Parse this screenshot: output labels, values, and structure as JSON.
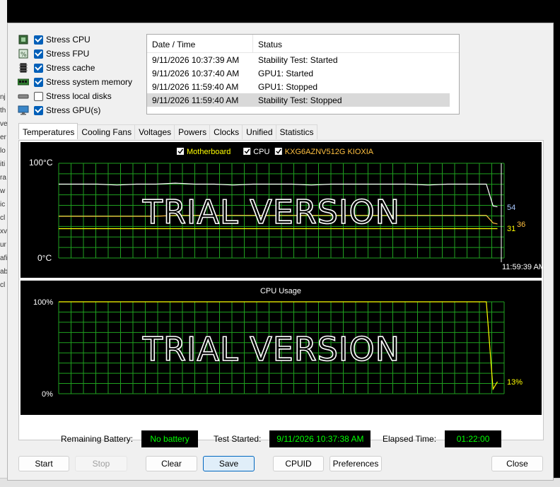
{
  "background_fragments": [
    "nj",
    "th",
    "ve",
    "er",
    "lo",
    "iti",
    "ra",
    "w",
    "ic",
    "cl",
    "xv",
    "ur",
    "afi",
    "ab",
    "cl"
  ],
  "options": [
    {
      "label": "Stress CPU",
      "checked": true,
      "icon": "cpu-chip-icon"
    },
    {
      "label": "Stress FPU",
      "checked": true,
      "icon": "fpu-chip-icon"
    },
    {
      "label": "Stress cache",
      "checked": true,
      "icon": "cache-chip-icon"
    },
    {
      "label": "Stress system memory",
      "checked": true,
      "icon": "memory-module-icon"
    },
    {
      "label": "Stress local disks",
      "checked": false,
      "icon": "disk-drive-icon"
    },
    {
      "label": "Stress GPU(s)",
      "checked": true,
      "icon": "monitor-icon"
    }
  ],
  "log": {
    "headers": [
      "Date / Time",
      "Status"
    ],
    "rows": [
      {
        "time": "9/11/2026 10:37:39 AM",
        "status": "Stability Test: Started"
      },
      {
        "time": "9/11/2026 10:37:40 AM",
        "status": "GPU1: Started"
      },
      {
        "time": "9/11/2026 11:59:40 AM",
        "status": "GPU1: Stopped"
      },
      {
        "time": "9/11/2026 11:59:40 AM",
        "status": "Stability Test: Stopped"
      }
    ]
  },
  "tabs": [
    "Temperatures",
    "Cooling Fans",
    "Voltages",
    "Powers",
    "Clocks",
    "Unified",
    "Statistics"
  ],
  "temp_graph": {
    "legend": [
      {
        "label": "Motherboard",
        "color": "#ffff00",
        "checked": true
      },
      {
        "label": "CPU",
        "color": "#ffffff",
        "checked": true
      },
      {
        "label": "KXG6AZNV512G KIOXIA",
        "color": "#ffc040",
        "checked": true
      }
    ],
    "y_top": "100°C",
    "y_bottom": "0°C",
    "watermark": "TRIAL VERSION",
    "time_label": "11:59:39 AM",
    "value_labels": [
      {
        "text": "54",
        "color": "#a8c8ff"
      },
      {
        "text": "31",
        "color": "#ffff00"
      },
      {
        "text": "36",
        "color": "#ffc040"
      }
    ]
  },
  "cpu_graph": {
    "title": "CPU Usage",
    "y_top": "100%",
    "y_bottom": "0%",
    "watermark": "TRIAL VERSION",
    "value_label": "13%",
    "color": "#ffff00"
  },
  "chart_data": [
    {
      "type": "line",
      "title": "",
      "ylim": [
        0,
        100
      ],
      "ylabel": "°C",
      "grid": true,
      "series": [
        {
          "name": "Motherboard",
          "values": [
            31,
            31,
            31,
            31,
            31,
            31,
            31,
            31,
            31,
            31,
            31,
            31,
            31,
            31,
            31,
            31,
            31,
            31,
            31,
            31,
            31,
            31,
            31,
            31,
            31
          ]
        },
        {
          "name": "CPU",
          "values": [
            78,
            78,
            78,
            77,
            78,
            78,
            79,
            78,
            78,
            77,
            78,
            78,
            78,
            77,
            78,
            78,
            78,
            78,
            78,
            77,
            78,
            78,
            78,
            55,
            54
          ]
        },
        {
          "name": "KXG6AZNV512G KIOXIA",
          "values": [
            44,
            44,
            44,
            44,
            44,
            44,
            45,
            45,
            45,
            45,
            45,
            45,
            45,
            45,
            45,
            45,
            45,
            45,
            45,
            45,
            45,
            45,
            45,
            37,
            36
          ]
        }
      ]
    },
    {
      "type": "line",
      "title": "CPU Usage",
      "ylim": [
        0,
        100
      ],
      "grid": true,
      "series": [
        {
          "name": "CPU Usage",
          "values": [
            100,
            100,
            100,
            100,
            100,
            100,
            100,
            100,
            100,
            100,
            100,
            100,
            100,
            100,
            100,
            100,
            100,
            100,
            100,
            100,
            100,
            100,
            100,
            5,
            13
          ]
        }
      ]
    }
  ],
  "status": {
    "battery_label": "Remaining Battery:",
    "battery_value": "No battery",
    "started_label": "Test Started:",
    "started_value": "9/11/2026 10:37:38 AM",
    "elapsed_label": "Elapsed Time:",
    "elapsed_value": "01:22:00"
  },
  "buttons": {
    "start": "Start",
    "stop": "Stop",
    "clear": "Clear",
    "save": "Save",
    "cpuid": "CPUID",
    "preferences": "Preferences",
    "close": "Close"
  }
}
